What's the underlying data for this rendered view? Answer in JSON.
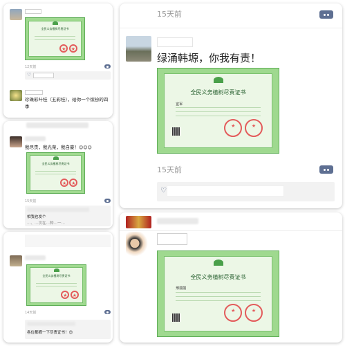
{
  "posts": {
    "p1": {
      "time": "12天前",
      "cert_title": "全民义务植树尽责证书"
    },
    "p2": {
      "text": "珍珠彩叶桂（五彩桂），给你一个缤纷的四季"
    },
    "p3": {
      "text": "我尽责，我光荣，我自豪！",
      "emoji": "😊😊😊",
      "time": "15天前",
      "cert_title": "全民义务植树尽责证书",
      "comment1": "相我也发个",
      "comment2": "…、…次在…种…一…"
    },
    "p4": {
      "time": "14天前",
      "cert_title": "全民义务植树尽责证书",
      "comment": "各位都晒一下尽责证书！😊"
    },
    "p5": {
      "time": "15天前",
      "text": "绿涌韩塬，你我有责！",
      "cert_title": "全民义务植树尽责证书",
      "cert_name": "宜军",
      "time2": "15天前"
    },
    "p6": {
      "cert_title": "全民义务植树尽责证书",
      "cert_name": "邢丽丽"
    }
  },
  "icons": [
    "more-options-icon",
    "like-icon"
  ],
  "colors": {
    "accent": "#5e6f92",
    "cert_green": "#9fd98f",
    "seal_red": "#e35b5b"
  }
}
